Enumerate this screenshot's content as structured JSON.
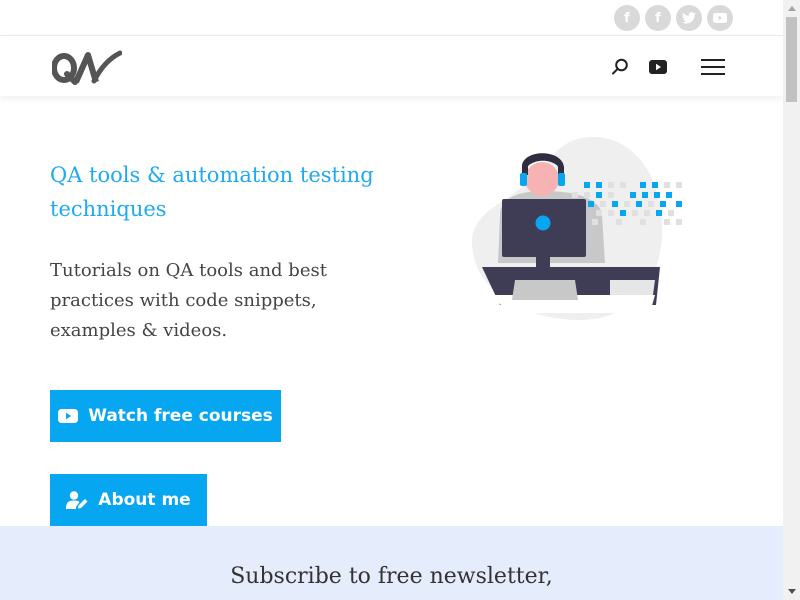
{
  "social": [
    {
      "name": "facebook",
      "icon": "facebook-icon",
      "glyph": "f"
    },
    {
      "name": "facebook",
      "icon": "facebook-icon",
      "glyph": "f"
    },
    {
      "name": "twitter",
      "icon": "twitter-icon",
      "glyph": ""
    },
    {
      "name": "youtube",
      "icon": "youtube-icon",
      "glyph": ""
    }
  ],
  "header": {
    "logo_text": "QA",
    "search_icon": "search-icon",
    "youtube_icon": "youtube-icon",
    "menu_icon": "hamburger-menu-icon"
  },
  "hero": {
    "title": "QA tools & automation testing techniques",
    "description": "Tutorials on QA tools and best practices with code snippets, examples & videos.",
    "courses_button": "Watch free courses",
    "about_button": "About me"
  },
  "newsletter": {
    "title": "Subscribe to free newsletter,"
  },
  "colors": {
    "accent": "#06a6f0",
    "title_blue": "#1eaaf1",
    "newsletter_bg": "#e5ecfb",
    "social_gray": "#d9d9d9"
  }
}
